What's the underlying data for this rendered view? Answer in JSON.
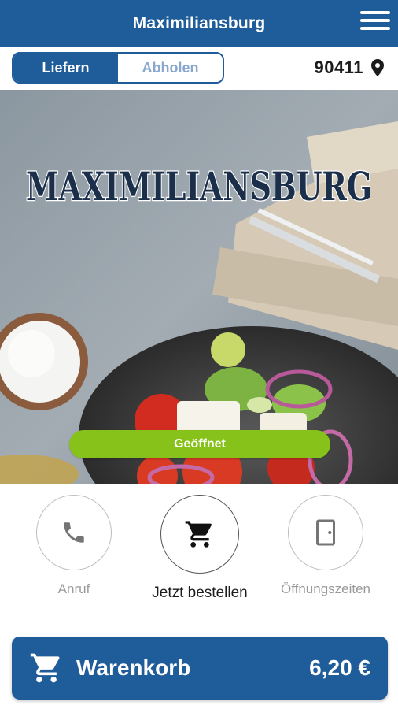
{
  "header": {
    "title": "Maximiliansburg"
  },
  "delivery_toggle": {
    "deliver": "Liefern",
    "pickup": "Abholen",
    "selected": "Liefern"
  },
  "location": {
    "zip": "90411"
  },
  "hero": {
    "logo_text": "MAXIMILIANSBURG",
    "status": "Geöffnet"
  },
  "actions": [
    {
      "label": "Anruf",
      "icon": "phone-icon"
    },
    {
      "label": "Jetzt bestellen",
      "icon": "cart-icon"
    },
    {
      "label": "Öffnungszeiten",
      "icon": "door-icon"
    }
  ],
  "cart": {
    "label": "Warenkorb",
    "total": "6,20 €",
    "icon": "cart-icon"
  },
  "colors": {
    "brand": "#1f5c9a",
    "open": "#86c21a",
    "inactive_text": "#8aa8cf"
  }
}
